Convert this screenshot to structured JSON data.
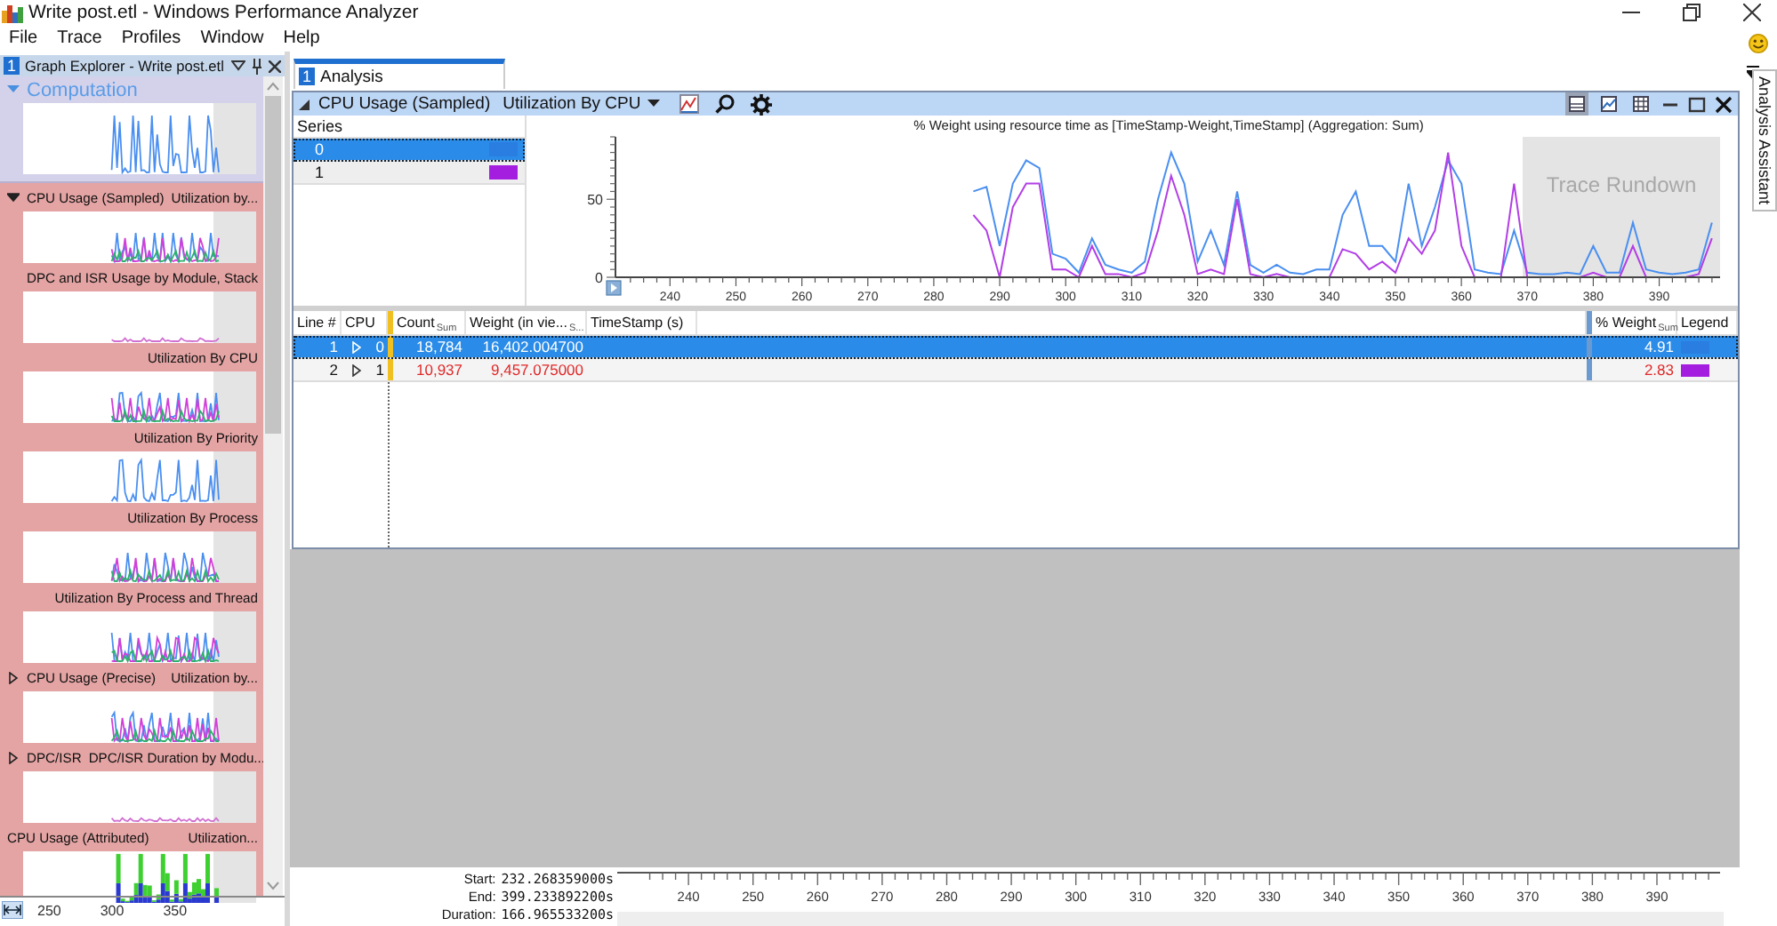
{
  "window": {
    "title": "Write post.etl - Windows Performance Analyzer"
  },
  "menu": [
    "File",
    "Trace",
    "Profiles",
    "Window",
    "Help"
  ],
  "graph_explorer": {
    "number": "1",
    "title": "Graph Explorer - Write post.etl",
    "sections": [
      {
        "name": "Computation",
        "expanded": true,
        "graphs": [
          {
            "group": "CPU Usage (Sampled)",
            "title": "Utilization by...",
            "expanded": true
          },
          {
            "title": "DPC and ISR Usage by Module, Stack"
          },
          {
            "title": "Utilization By CPU"
          },
          {
            "title": "Utilization By Priority"
          },
          {
            "title": "Utilization By Process"
          },
          {
            "title": "Utilization By Process and Thread"
          },
          {
            "group": "CPU Usage (Precise)",
            "title": "Utilization by...",
            "expanded": false
          },
          {
            "group": "DPC/ISR",
            "title": "DPC/ISR Duration by Modu...",
            "expanded": false
          },
          {
            "group": "CPU Usage (Attributed)",
            "title": "Utilization..."
          }
        ]
      }
    ],
    "axis_ticks": [
      "250",
      "300",
      "350"
    ]
  },
  "analysis_tab": {
    "number": "1",
    "label": "Analysis",
    "selected": true
  },
  "graph": {
    "category": "CPU Usage (Sampled)",
    "preset": "Utilization By CPU",
    "view_buttons": [
      {
        "selected": true
      },
      {
        "selected": false
      },
      {
        "selected": false
      }
    ],
    "series_header": "Series",
    "series": [
      {
        "name": "0",
        "color": "#2a7de1",
        "selected": true
      },
      {
        "name": "1",
        "color": "#a41ee0",
        "selected": false
      }
    ],
    "chart_data": {
      "type": "line",
      "title": "% Weight using resource time as [TimeStamp-Weight,TimeStamp] (Aggregation: Sum)",
      "x": [
        286,
        288,
        290,
        292,
        294,
        296,
        298,
        300,
        302,
        304,
        306,
        308,
        310,
        312,
        314,
        316,
        318,
        320,
        322,
        324,
        326,
        328,
        330,
        332,
        334,
        336,
        338,
        340,
        342,
        344,
        346,
        348,
        350,
        352,
        354,
        356,
        358,
        360,
        362,
        364,
        366,
        368,
        370,
        372,
        374,
        376,
        378,
        380,
        382,
        384,
        386,
        388,
        390,
        392,
        394,
        396,
        398
      ],
      "series": [
        {
          "color": "#4a8ff0",
          "values": [
            55,
            58,
            20,
            60,
            75,
            70,
            15,
            12,
            3,
            25,
            8,
            5,
            3,
            10,
            50,
            80,
            60,
            10,
            30,
            8,
            55,
            8,
            3,
            8,
            3,
            2,
            5,
            5,
            40,
            55,
            20,
            20,
            10,
            60,
            20,
            45,
            75,
            60,
            5,
            3,
            2,
            30,
            3,
            2,
            2,
            3,
            2,
            20,
            3,
            3,
            35,
            5,
            3,
            2,
            3,
            5,
            35
          ]
        },
        {
          "color": "#b23ee6",
          "values": [
            40,
            30,
            0,
            45,
            60,
            60,
            5,
            5,
            0,
            20,
            2,
            2,
            0,
            3,
            30,
            65,
            40,
            2,
            5,
            2,
            50,
            2,
            0,
            2,
            0,
            0,
            0,
            0,
            18,
            15,
            5,
            10,
            3,
            25,
            15,
            30,
            80,
            20,
            0,
            0,
            0,
            60,
            0,
            null,
            null,
            null,
            0,
            3,
            0,
            0,
            20,
            0,
            null,
            null,
            0,
            2,
            25
          ]
        }
      ],
      "xlim": [
        232.27,
        399.23
      ],
      "ylim": [
        0,
        90
      ],
      "xticks": [
        240,
        250,
        260,
        270,
        280,
        290,
        300,
        310,
        320,
        330,
        340,
        350,
        360,
        370,
        380,
        390
      ],
      "yticks": [
        0,
        50
      ]
    },
    "overlay_label": "Trace Rundown"
  },
  "table": {
    "columns": [
      {
        "label": "Line #"
      },
      {
        "label": "CPU"
      },
      {
        "label": "Count",
        "aggregation": "Sum"
      },
      {
        "label": "Weight (in vie...",
        "aggregation": "S..."
      },
      {
        "label": "TimeStamp (s)"
      },
      {
        "label": "% Weight",
        "aggregation": "Sum"
      },
      {
        "label": "Legend"
      }
    ],
    "rows": [
      {
        "line": "1",
        "cpu": "0",
        "count": "18,784",
        "weight": "16,402.004700",
        "percent": "4.91",
        "color": "#2a7de1",
        "selected": true
      },
      {
        "line": "2",
        "cpu": "1",
        "count": "10,937",
        "weight": "9,457.075000",
        "percent": "2.83",
        "color": "#a41ee0",
        "selected": false
      }
    ]
  },
  "timeline": {
    "start_label": "Start:",
    "start": "232.268359000s",
    "end_label": "End:",
    "end": "399.233892200s",
    "duration_label": "Duration:",
    "duration": "166.965533200s",
    "ticks": [
      "240",
      "250",
      "260",
      "270",
      "280",
      "290",
      "300",
      "310",
      "320",
      "330",
      "340",
      "350",
      "360",
      "370",
      "380",
      "390"
    ]
  },
  "assistant_tab": "Analysis Assistant"
}
